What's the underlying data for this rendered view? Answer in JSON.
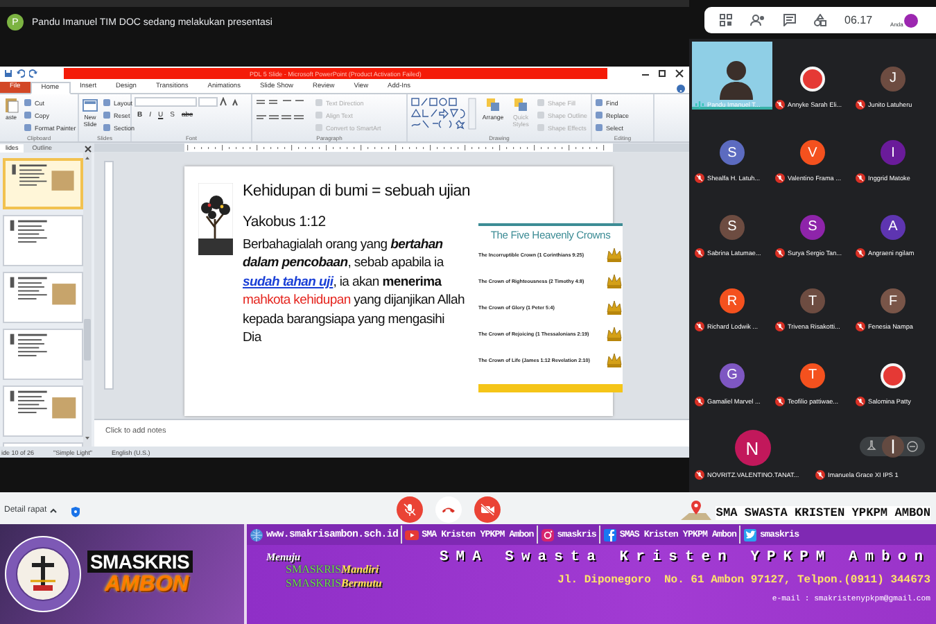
{
  "meeting": {
    "presenter_avatar": "P",
    "presenting_banner": "Pandu Imanuel TIM DOC sedang melakukan presentasi",
    "time": "06.17",
    "self_label": "Anda"
  },
  "powerpoint": {
    "title": "PDL 5 Slide  -  Microsoft PowerPoint (Product Activation Failed)",
    "tabs": [
      {
        "label": "File",
        "kind": "file",
        "selected": false
      },
      {
        "label": "Home",
        "kind": "tab",
        "selected": true
      },
      {
        "label": "Insert",
        "kind": "tab",
        "selected": false
      },
      {
        "label": "Design",
        "kind": "tab",
        "selected": false
      },
      {
        "label": "Transitions",
        "kind": "tab",
        "selected": false
      },
      {
        "label": "Animations",
        "kind": "tab",
        "selected": false
      },
      {
        "label": "Slide Show",
        "kind": "tab",
        "selected": false
      },
      {
        "label": "Review",
        "kind": "tab",
        "selected": false
      },
      {
        "label": "View",
        "kind": "tab",
        "selected": false
      },
      {
        "label": "Add-Ins",
        "kind": "tab",
        "selected": false
      }
    ],
    "ribbon_groups": [
      {
        "kind": "clipboard",
        "label": "Clipboard",
        "large": [
          {
            "label": "aste",
            "disabled": false
          }
        ],
        "small": [
          {
            "label": "Cut",
            "disabled": false
          },
          {
            "label": "Copy",
            "disabled": false
          },
          {
            "label": "Format Painter",
            "disabled": false
          }
        ]
      },
      {
        "kind": "slides",
        "label": "Slides",
        "large": [
          {
            "label": "New Slide",
            "disabled": false
          }
        ],
        "small": [
          {
            "label": "Layout",
            "disabled": false
          },
          {
            "label": "Reset",
            "disabled": false
          },
          {
            "label": "Section",
            "disabled": false
          }
        ]
      },
      {
        "kind": "font",
        "label": "Font",
        "buttons": [
          "B",
          "I",
          "U",
          "S",
          "abc"
        ]
      },
      {
        "kind": "paragraph",
        "label": "Paragraph",
        "small": [
          {
            "label": "Text Direction",
            "disabled": true
          },
          {
            "label": "Align Text",
            "disabled": true
          },
          {
            "label": "Convert to SmartArt",
            "disabled": true
          }
        ]
      },
      {
        "kind": "drawing",
        "label": "Drawing",
        "large": [
          {
            "label": "Arrange",
            "disabled": false
          },
          {
            "label": "Quick Styles",
            "disabled": true
          }
        ],
        "small": [
          {
            "label": "Shape Fill",
            "disabled": true
          },
          {
            "label": "Shape Outline",
            "disabled": true
          },
          {
            "label": "Shape Effects",
            "disabled": true
          }
        ]
      },
      {
        "kind": "editing",
        "label": "Editing",
        "small": [
          {
            "label": "Find",
            "disabled": false
          },
          {
            "label": "Replace",
            "disabled": false
          },
          {
            "label": "Select",
            "disabled": false
          }
        ]
      }
    ],
    "pane_tabs": [
      {
        "label": "lides",
        "selected": true
      },
      {
        "label": "Outline",
        "selected": false
      }
    ],
    "thumbnails": [
      {
        "selected": true
      },
      {
        "selected": false
      },
      {
        "selected": false
      },
      {
        "selected": false
      },
      {
        "selected": false
      },
      {
        "selected": false
      }
    ],
    "slide": {
      "title": "Kehidupan di bumi = sebuah ujian",
      "reference": "Yakobus 1:12",
      "verse": [
        {
          "text": "Berbahagialah orang yang ",
          "kind": "plain"
        },
        {
          "text": "bertahan dalam pencobaan",
          "kind": "emphasis"
        },
        {
          "text": ", sebab apabila ia ",
          "kind": "plain"
        },
        {
          "text": "sudah tahan uji",
          "kind": "link"
        },
        {
          "text": ", ia akan ",
          "kind": "plain"
        },
        {
          "text": "menerima ",
          "kind": "strong"
        },
        {
          "text": "mahkota kehidupan",
          "kind": "highlight"
        },
        {
          "text": " yang dijanjikan Allah kepada barangsiapa yang mengasihi Dia",
          "kind": "plain"
        }
      ],
      "crowns": {
        "title": "The Five Heavenly Crowns",
        "items": [
          "The Incorruptible Crown (1 Corinthians 9:25)",
          "The Crown of Righteousness (2 Timothy 4:8)",
          "The Crown of Glory (1 Peter 5:4)",
          "The Crown of Rejoicing (1 Thessalonians 2:19)",
          "The Crown of Life (James 1:12 Revelation 2:10)"
        ]
      }
    },
    "notes_placeholder": "Click to add notes",
    "status": [
      "ide 10 of 26",
      "\"Simple Light\"",
      "English (U.S.)"
    ]
  },
  "participants": [
    {
      "name": "Pandu Imanuel T...",
      "kind": "video",
      "muted": false
    },
    {
      "name": "Annyke Sarah Eli...",
      "kind": "photo",
      "muted": true
    },
    {
      "name": "Junito Latuheru",
      "kind": "avatar",
      "initial": "J",
      "color": "#6d4c41",
      "muted": true
    },
    {
      "name": "Shealfa H. Latuh...",
      "kind": "avatar",
      "initial": "S",
      "color": "#5c6bc0",
      "muted": true
    },
    {
      "name": "Valentino Frama ...",
      "kind": "avatar",
      "initial": "V",
      "color": "#f4511e",
      "muted": true
    },
    {
      "name": "Inggrid Matoke",
      "kind": "avatar",
      "initial": "I",
      "color": "#6a1b9a",
      "muted": true
    },
    {
      "name": "Sabrina Latumae...",
      "kind": "avatar",
      "initial": "S",
      "color": "#6d4c41",
      "muted": true
    },
    {
      "name": "Surya Sergio Tan...",
      "kind": "avatar",
      "initial": "S",
      "color": "#8e24aa",
      "muted": true
    },
    {
      "name": "Angraeni ngilam",
      "kind": "avatar",
      "initial": "A",
      "color": "#5e35b1",
      "muted": true
    },
    {
      "name": "Richard Lodwik ...",
      "kind": "avatar",
      "initial": "R",
      "color": "#f4511e",
      "muted": true
    },
    {
      "name": "Trivena Risakotti...",
      "kind": "avatar",
      "initial": "T",
      "color": "#6d4c41",
      "muted": true
    },
    {
      "name": "Fenesia Nampa",
      "kind": "avatar",
      "initial": "F",
      "color": "#795548",
      "muted": true
    },
    {
      "name": "Gamaliel Marvel ...",
      "kind": "avatar",
      "initial": "G",
      "color": "#7e57c2",
      "muted": true
    },
    {
      "name": "Teofilio pattiwae...",
      "kind": "avatar",
      "initial": "T",
      "color": "#f4511e",
      "muted": true
    },
    {
      "name": "Salomina Patty",
      "kind": "photo",
      "muted": true
    },
    {
      "name": "NOVRITZ.VALENTINO.TANAT...",
      "kind": "avatar",
      "initial": "N",
      "color": "#c2185b",
      "muted": true
    },
    {
      "name": "Imanuela Grace XI IPS 1",
      "kind": "blank",
      "muted": true
    }
  ],
  "call_bar": {
    "details_label": "Detail rapat",
    "controls": [
      {
        "kind": "mic",
        "on": false
      },
      {
        "kind": "hangup"
      },
      {
        "kind": "camera",
        "on": false
      }
    ]
  },
  "banner": {
    "location_label": "SMA SWASTA KRISTEN YPKPM AMBON",
    "links": [
      {
        "kind": "web",
        "label": "www.smakrisambon.sch.id"
      },
      {
        "kind": "youtube",
        "label": "SMA Kristen YPKPM Ambon"
      },
      {
        "kind": "instagram",
        "label": "smaskris"
      },
      {
        "kind": "facebook",
        "label": "SMAS Kristen YPKPM Ambon"
      },
      {
        "kind": "twitter",
        "label": "smaskris"
      }
    ],
    "brand": [
      "SMASKRIS",
      "AMBON"
    ],
    "motto_intro": "Menuju",
    "mottos": [
      {
        "prefix": "SMASKRIS",
        "word": "Mandiri"
      },
      {
        "prefix": "SMASKRIS",
        "word": "Bermutu"
      }
    ],
    "school_name": "SMA Swasta Kristen YPKPM Ambon",
    "address": "Jl. Diponegoro  No. 61 Ambon 97127, Telpon.(0911) 344673",
    "email": "e-mail : smakristenypkpm@gmail.com"
  }
}
